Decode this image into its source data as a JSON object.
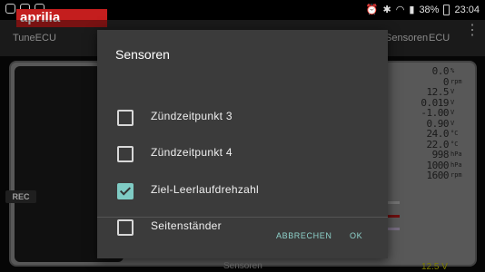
{
  "status_bar": {
    "battery": "38%",
    "time": "23:04"
  },
  "app_bar": {
    "title": "TuneECU",
    "tab_sensoren": "Sensoren",
    "tab_ecu": "ECU",
    "more_icon": "more-vert-icon"
  },
  "background": {
    "logo": "aprilia",
    "rec_label": "REC",
    "bottom_label": "Sensoren",
    "voltage": "12.5 V",
    "readouts": [
      {
        "value": "0.0",
        "unit": "%"
      },
      {
        "value": "0",
        "unit": "rpm"
      },
      {
        "value": "12.5",
        "unit": "V"
      },
      {
        "value": "0.019",
        "unit": "V"
      },
      {
        "value": "-1.00",
        "unit": "V"
      },
      {
        "value": "0.90",
        "unit": "V"
      },
      {
        "value": "24.0",
        "unit": "°C"
      },
      {
        "value": "22.0",
        "unit": "°C"
      },
      {
        "value": "998",
        "unit": "hPa"
      },
      {
        "value": "1000",
        "unit": "hPa"
      },
      {
        "value": "1600",
        "unit": "rpm"
      }
    ]
  },
  "dialog": {
    "title": "Sensoren",
    "options": [
      {
        "label": "Zündzeitpunkt 3",
        "checked": false
      },
      {
        "label": "Zündzeitpunkt 4",
        "checked": false
      },
      {
        "label": "Ziel-Leerlaufdrehzahl",
        "checked": true
      },
      {
        "label": "Seitenständer",
        "checked": false
      }
    ],
    "cancel_label": "ABBRECHEN",
    "ok_label": "OK",
    "accent": "#7fcbc4"
  }
}
